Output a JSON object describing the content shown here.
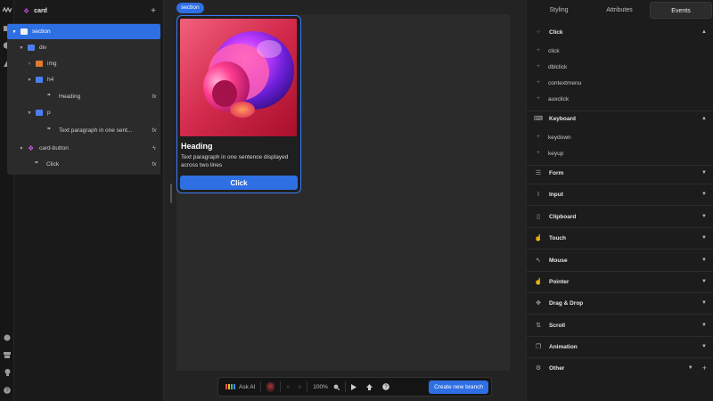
{
  "layers": {
    "title": "card",
    "items": [
      {
        "label": "section",
        "icon": "section-icon"
      },
      {
        "label": "div",
        "icon": "div-icon"
      },
      {
        "label": "img",
        "icon": "image-icon"
      },
      {
        "label": "h4",
        "icon": "heading-tag-icon"
      },
      {
        "label": "Heading",
        "icon": "text-quote-icon",
        "fx": "fx"
      },
      {
        "label": "p",
        "icon": "paragraph-tag-icon"
      },
      {
        "label": "Text paragraph in one sent...",
        "icon": "text-quote-icon",
        "fx": "fx"
      },
      {
        "label": "card-button",
        "icon": "component-icon",
        "action": "lightning-icon"
      },
      {
        "label": "Click",
        "icon": "text-quote-icon",
        "fx": "fx"
      }
    ]
  },
  "canvas": {
    "badge": "section",
    "card": {
      "heading": "Heading",
      "text": "Text paragraph in one sentence displayed across two lines",
      "button": "Click"
    }
  },
  "toolbar": {
    "ask_ai": "Ask AI",
    "zoom": "100%",
    "create_branch": "Create new branch"
  },
  "right_panel": {
    "tabs": [
      "Styling",
      "Attributes",
      "Events"
    ],
    "active_tab": "Events",
    "sections": {
      "click": {
        "title": "Click",
        "events": [
          "click",
          "dblclick",
          "contextmenu",
          "auxclick"
        ]
      },
      "keyboard": {
        "title": "Keyboard",
        "events": [
          "keydown",
          "keyup"
        ]
      },
      "form": {
        "title": "Form"
      },
      "input": {
        "title": "Input"
      },
      "clipboard": {
        "title": "Clipboard"
      },
      "touch": {
        "title": "Touch"
      },
      "mouse": {
        "title": "Mouse"
      },
      "pointer": {
        "title": "Pointer"
      },
      "drag": {
        "title": "Drag & Drop"
      },
      "scroll": {
        "title": "Scroll"
      },
      "animation": {
        "title": "Animation"
      },
      "other": {
        "title": "Other"
      }
    }
  },
  "colors": {
    "accent": "#2f6fe4",
    "component": "#c65ce8",
    "image": "#e07a2f"
  }
}
